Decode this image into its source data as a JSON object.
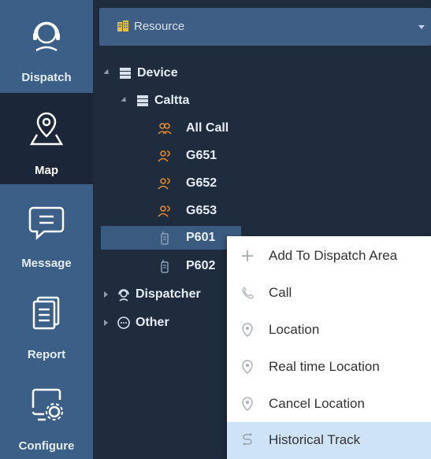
{
  "nav": {
    "items": [
      {
        "label": "Dispatch",
        "icon": "headset-icon",
        "active": false
      },
      {
        "label": "Map",
        "icon": "map-pin-icon",
        "active": true
      },
      {
        "label": "Message",
        "icon": "message-icon",
        "active": false
      },
      {
        "label": "Report",
        "icon": "report-icon",
        "active": false
      },
      {
        "label": "Configure",
        "icon": "configure-icon",
        "active": false
      }
    ]
  },
  "resource": {
    "label": "Resource"
  },
  "tree": {
    "device": "Device",
    "caltta": "Caltta",
    "all_call": "All Call",
    "g651": "G651",
    "g652": "G652",
    "g653": "G653",
    "p601": "P601",
    "p602": "P602",
    "dispatcher": "Dispatcher",
    "other": "Other"
  },
  "context_menu": {
    "items": [
      {
        "label": "Add To Dispatch Area",
        "icon": "plus-icon"
      },
      {
        "label": "Call",
        "icon": "phone-icon"
      },
      {
        "label": "Location",
        "icon": "location-pin-icon"
      },
      {
        "label": "Real time Location",
        "icon": "location-pin-icon"
      },
      {
        "label": "Cancel Location",
        "icon": "location-pin-icon"
      },
      {
        "label": "Historical Track",
        "icon": "track-icon",
        "highlighted": true
      }
    ]
  },
  "colors": {
    "nav_bg": "#3c5f88",
    "nav_active_bg": "#1b2738",
    "panel_bg": "#1f2c3e",
    "selected_row": "#3b5a80",
    "menu_highlight": "#cfe3f6",
    "icon_orange": "#e08a2c"
  }
}
